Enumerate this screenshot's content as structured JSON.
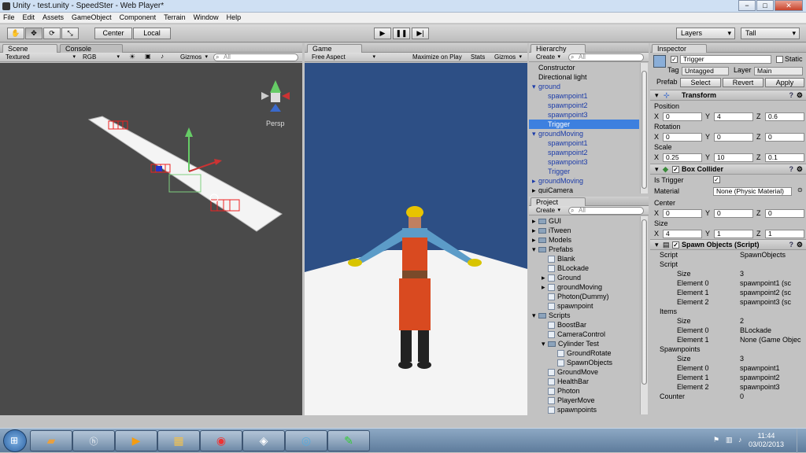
{
  "window": {
    "title": "Unity - test.unity - SpeedSter - Web Player*",
    "min": "−",
    "max": "□",
    "close": "✕"
  },
  "menu": [
    "File",
    "Edit",
    "Assets",
    "GameObject",
    "Component",
    "Terrain",
    "Window",
    "Help"
  ],
  "toolbar": {
    "center_label": "Center",
    "local_label": "Local",
    "layers_label": "Layers",
    "layout_label": "Tall"
  },
  "scene": {
    "tab": "Scene",
    "console_tab": "Console",
    "shading": "Textured",
    "rgb": "RGB",
    "gizmos": "Gizmos",
    "search_placeholder": "All",
    "persp": "Persp"
  },
  "game": {
    "tab": "Game",
    "aspect": "Free Aspect",
    "maximize": "Maximize on Play",
    "stats": "Stats",
    "gizmos": "Gizmos"
  },
  "hierarchy": {
    "tab": "Hierarchy",
    "create": "Create",
    "search_placeholder": "All",
    "items": [
      {
        "label": "Constructor",
        "indent": 0,
        "color": "black",
        "arrow": ""
      },
      {
        "label": "Directional light",
        "indent": 0,
        "color": "black",
        "arrow": ""
      },
      {
        "label": "ground",
        "indent": 0,
        "color": "blue",
        "arrow": "▾"
      },
      {
        "label": "spawnpoint1",
        "indent": 1,
        "color": "blue",
        "arrow": ""
      },
      {
        "label": "spawnpoint2",
        "indent": 1,
        "color": "blue",
        "arrow": ""
      },
      {
        "label": "spawnpoint3",
        "indent": 1,
        "color": "blue",
        "arrow": ""
      },
      {
        "label": "Trigger",
        "indent": 1,
        "color": "white",
        "arrow": "",
        "selected": true
      },
      {
        "label": "groundMoving",
        "indent": 0,
        "color": "blue",
        "arrow": "▾"
      },
      {
        "label": "spawnpoint1",
        "indent": 1,
        "color": "blue",
        "arrow": ""
      },
      {
        "label": "spawnpoint2",
        "indent": 1,
        "color": "blue",
        "arrow": ""
      },
      {
        "label": "spawnpoint3",
        "indent": 1,
        "color": "blue",
        "arrow": ""
      },
      {
        "label": "Trigger",
        "indent": 1,
        "color": "blue",
        "arrow": ""
      },
      {
        "label": "groundMoving",
        "indent": 0,
        "color": "blue",
        "arrow": "▸"
      },
      {
        "label": "guiCamera",
        "indent": 0,
        "color": "black",
        "arrow": "▸"
      }
    ]
  },
  "project": {
    "tab": "Project",
    "create": "Create",
    "search_placeholder": "All",
    "items": [
      {
        "label": "GUI",
        "indent": 0,
        "type": "folder",
        "arrow": "▸"
      },
      {
        "label": "iTween",
        "indent": 0,
        "type": "folder",
        "arrow": "▸"
      },
      {
        "label": "Models",
        "indent": 0,
        "type": "folder",
        "arrow": "▸"
      },
      {
        "label": "Prefabs",
        "indent": 0,
        "type": "folder",
        "arrow": "▾"
      },
      {
        "label": "Blank",
        "indent": 1,
        "type": "asset",
        "arrow": ""
      },
      {
        "label": "BLockade",
        "indent": 1,
        "type": "asset",
        "arrow": ""
      },
      {
        "label": "Ground",
        "indent": 1,
        "type": "asset",
        "arrow": "▸"
      },
      {
        "label": "groundMoving",
        "indent": 1,
        "type": "asset",
        "arrow": "▸"
      },
      {
        "label": "Photon(Dummy)",
        "indent": 1,
        "type": "asset",
        "arrow": ""
      },
      {
        "label": "spawnpoint",
        "indent": 1,
        "type": "asset",
        "arrow": ""
      },
      {
        "label": "Scripts",
        "indent": 0,
        "type": "folder",
        "arrow": "▾"
      },
      {
        "label": "BoostBar",
        "indent": 1,
        "type": "asset",
        "arrow": ""
      },
      {
        "label": "CameraControl",
        "indent": 1,
        "type": "asset",
        "arrow": ""
      },
      {
        "label": "Cylinder Test",
        "indent": 1,
        "type": "folder",
        "arrow": "▾"
      },
      {
        "label": "GroundRotate",
        "indent": 2,
        "type": "asset",
        "arrow": ""
      },
      {
        "label": "SpawnObjects",
        "indent": 2,
        "type": "asset",
        "arrow": ""
      },
      {
        "label": "GroundMove",
        "indent": 1,
        "type": "asset",
        "arrow": ""
      },
      {
        "label": "HealthBar",
        "indent": 1,
        "type": "asset",
        "arrow": ""
      },
      {
        "label": "Photon",
        "indent": 1,
        "type": "asset",
        "arrow": ""
      },
      {
        "label": "PlayerMove",
        "indent": 1,
        "type": "asset",
        "arrow": ""
      },
      {
        "label": "spawnpoints",
        "indent": 1,
        "type": "asset",
        "arrow": ""
      }
    ]
  },
  "inspector": {
    "tab": "Inspector",
    "name": "Trigger",
    "static_label": "Static",
    "tag_label": "Tag",
    "tag_value": "Untagged",
    "layer_label": "Layer",
    "layer_value": "Main",
    "prefab_label": "Prefab",
    "select": "Select",
    "revert": "Revert",
    "apply": "Apply",
    "transform": {
      "title": "Transform",
      "position_label": "Position",
      "position": [
        "0",
        "4",
        "0.6"
      ],
      "rotation_label": "Rotation",
      "rotation": [
        "0",
        "0",
        "0"
      ],
      "scale_label": "Scale",
      "scale": [
        "0.25",
        "10",
        "0.1"
      ]
    },
    "axes": [
      "X",
      "Y",
      "Z"
    ],
    "box_collider": {
      "title": "Box Collider",
      "is_trigger_label": "Is Trigger",
      "material_label": "Material",
      "material_value": "None (Physic Material)",
      "center_label": "Center",
      "center": [
        "0",
        "0",
        "0"
      ],
      "size_label": "Size",
      "size": [
        "4",
        "1",
        "1"
      ]
    },
    "spawn": {
      "title": "Spawn Objects (Script)",
      "script_label": "Script",
      "script_value": "SpawnObjects",
      "script_group": "Script",
      "size_label": "Size",
      "script_size": "3",
      "script_elements": [
        {
          "label": "Element 0",
          "value": "spawnpoint1 (sc"
        },
        {
          "label": "Element 1",
          "value": "spawnpoint2 (sc"
        },
        {
          "label": "Element 2",
          "value": "spawnpoint3 (sc"
        }
      ],
      "items_group": "Items",
      "items_size": "2",
      "items_elements": [
        {
          "label": "Element 0",
          "value": "BLockade"
        },
        {
          "label": "Element 1",
          "value": "None (Game Objec"
        }
      ],
      "spawnpoints_group": "Spawnpoints",
      "spawnpoints_size": "3",
      "spawnpoints_elements": [
        {
          "label": "Element 0",
          "value": "spawnpoint1"
        },
        {
          "label": "Element 1",
          "value": "spawnpoint2"
        },
        {
          "label": "Element 2",
          "value": "spawnpoint3"
        }
      ],
      "counter_label": "Counter",
      "counter_value": "0"
    }
  },
  "clock": {
    "time": "11:44",
    "date": "03/02/2013"
  },
  "colors": {
    "scene_bg": "#4a4a4a",
    "game_sky": "#2d4f85",
    "selection": "#3d80df"
  }
}
